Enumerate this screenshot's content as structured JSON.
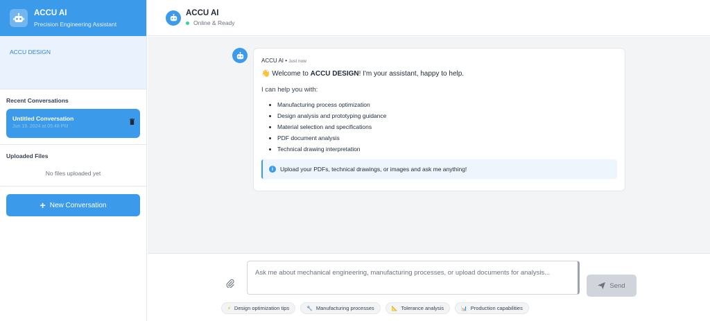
{
  "sidebar": {
    "brand_title": "ACCU AI",
    "brand_subtitle": "Precision Engineering Assistant",
    "design_label": "ACCU DESIGN",
    "recent_title": "Recent Conversations",
    "conversations": [
      {
        "title": "Untitled Conversation",
        "date": "Jun 19, 2024 at 05:48 PM"
      }
    ],
    "uploaded_title": "Uploaded Files",
    "no_files": "No files uploaded yet",
    "new_conversation": "New Conversation"
  },
  "header": {
    "title": "ACCU AI",
    "status": "Online & Ready",
    "status_color": "#34d399"
  },
  "message": {
    "sender": "ACCU AI",
    "time": "Just now",
    "welcome_emoji": "👋",
    "welcome_prefix": "Welcome to ",
    "welcome_bold": "ACCU DESIGN",
    "welcome_suffix": "! I'm your assistant, happy to help.",
    "intro": "I can help you with:",
    "capabilities": [
      "Manufacturing process optimization",
      "Design analysis and prototyping guidance",
      "Material selection and specifications",
      "PDF document analysis",
      "Technical drawing interpretation"
    ],
    "tip": "Upload your PDFs, technical drawings, or images and ask me anything!"
  },
  "input": {
    "placeholder": "Ask me about mechanical engineering, manufacturing processes, or upload documents for analysis...",
    "send_label": "Send"
  },
  "suggestions": [
    {
      "icon": "bolt-icon",
      "label": "Design optimization tips"
    },
    {
      "icon": "wrench-icon",
      "label": "Manufacturing processes"
    },
    {
      "icon": "ruler-icon",
      "label": "Tolerance analysis"
    },
    {
      "icon": "bar-chart-icon",
      "label": "Production capabilities"
    }
  ],
  "colors": {
    "accent": "#3b9ae9",
    "chat_background": "#f3f4f6",
    "send_disabled": "#d1d5db"
  }
}
